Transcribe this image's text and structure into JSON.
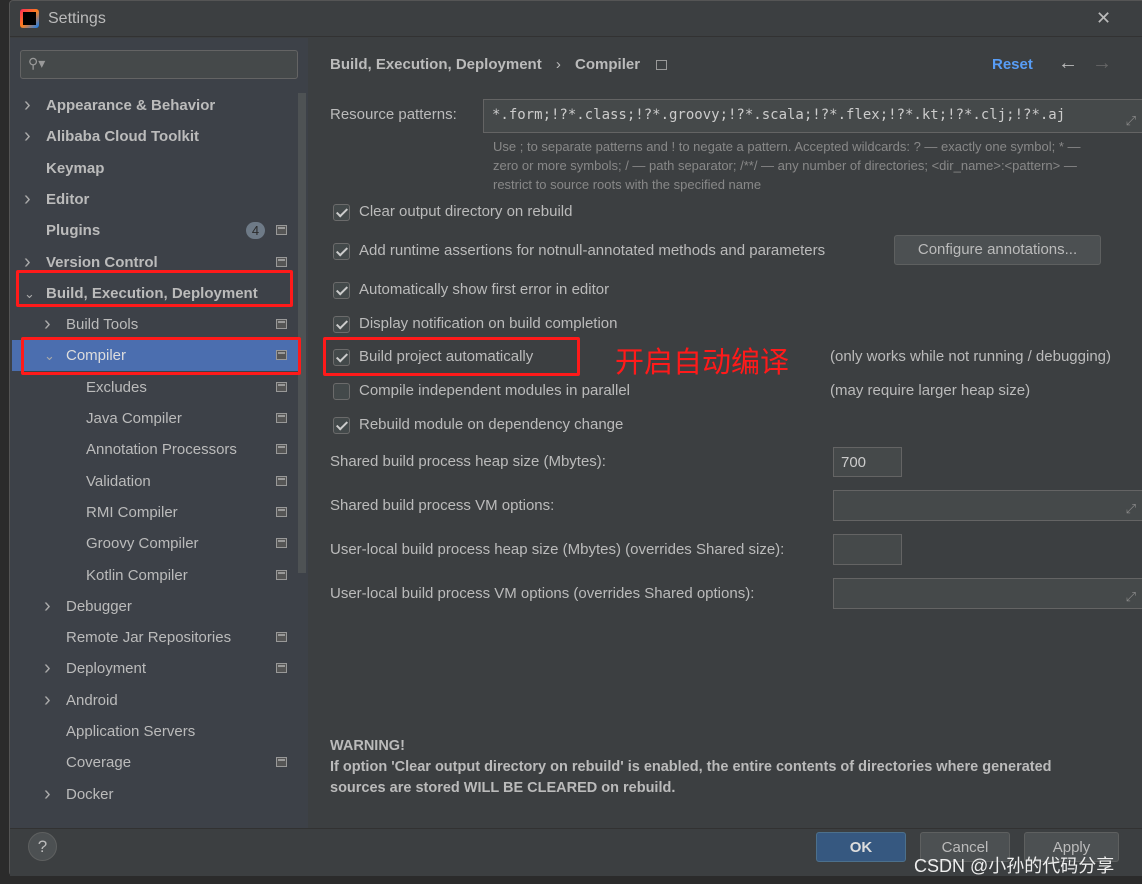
{
  "window": {
    "title": "Settings",
    "close": "✕"
  },
  "sidebar": {
    "items": [
      {
        "label": "Appearance & Behavior",
        "arrow": "›",
        "bold": true
      },
      {
        "label": "Alibaba Cloud Toolkit",
        "arrow": "›",
        "bold": true
      },
      {
        "label": "Keymap",
        "arrow": "",
        "bold": true
      },
      {
        "label": "Editor",
        "arrow": "›",
        "bold": true
      },
      {
        "label": "Plugins",
        "arrow": "",
        "bold": true,
        "badge": "4",
        "page": true
      },
      {
        "label": "Version Control",
        "arrow": "›",
        "bold": true,
        "page": true
      },
      {
        "label": "Build, Execution, Deployment",
        "arrow": "⌄",
        "bold": true
      },
      {
        "label": "Build Tools",
        "arrow": "›",
        "level": 1,
        "page": true
      },
      {
        "label": "Compiler",
        "arrow": "⌄",
        "level": 1,
        "page": true,
        "selected": true
      },
      {
        "label": "Excludes",
        "level": 2,
        "page": true
      },
      {
        "label": "Java Compiler",
        "level": 2,
        "page": true
      },
      {
        "label": "Annotation Processors",
        "level": 2,
        "page": true
      },
      {
        "label": "Validation",
        "level": 2,
        "page": true
      },
      {
        "label": "RMI Compiler",
        "level": 2,
        "page": true
      },
      {
        "label": "Groovy Compiler",
        "level": 2,
        "page": true
      },
      {
        "label": "Kotlin Compiler",
        "level": 2,
        "page": true
      },
      {
        "label": "Debugger",
        "arrow": "›",
        "level": 1
      },
      {
        "label": "Remote Jar Repositories",
        "level": 1,
        "page": true
      },
      {
        "label": "Deployment",
        "arrow": "›",
        "level": 1,
        "page": true
      },
      {
        "label": "Android",
        "arrow": "›",
        "level": 1
      },
      {
        "label": "Application Servers",
        "level": 1
      },
      {
        "label": "Coverage",
        "level": 1,
        "page": true
      },
      {
        "label": "Docker",
        "arrow": "›",
        "level": 1
      }
    ]
  },
  "header": {
    "crumb1": "Build, Execution, Deployment",
    "sep": "›",
    "crumb2": "Compiler",
    "reset": "Reset",
    "back": "←",
    "forward": "→"
  },
  "resource": {
    "label": "Resource patterns:",
    "value": "*.form;!?*.class;!?*.groovy;!?*.scala;!?*.flex;!?*.kt;!?*.clj;!?*.aj",
    "help1": "Use ; to separate patterns and ! to negate a pattern. Accepted wildcards: ? — exactly one symbol; * —",
    "help2": "zero or more symbols; / — path separator; /**/ — any number of directories; <dir_name>:<pattern> —",
    "help3": "restrict to source roots with the specified name"
  },
  "options": [
    {
      "label": "Clear output directory on rebuild",
      "checked": true
    },
    {
      "label": "Add runtime assertions for notnull-annotated methods and parameters",
      "checked": true
    },
    {
      "label": "Automatically show first error in editor",
      "checked": true
    },
    {
      "label": "Display notification on build completion",
      "checked": true
    },
    {
      "label": "Build project automatically",
      "checked": true,
      "note": "(only works while not running / debugging)"
    },
    {
      "label": "Compile independent modules in parallel",
      "checked": false,
      "note": "(may require larger heap size)"
    },
    {
      "label": "Rebuild module on dependency change",
      "checked": true
    }
  ],
  "configure_annotations": "Configure annotations...",
  "annotation": "开启自动编译",
  "fields": {
    "heap_label": "Shared build process heap size (Mbytes):",
    "heap_value": "700",
    "vm_label": "Shared build process VM options:",
    "user_heap_label": "User-local build process heap size (Mbytes) (overrides Shared size):",
    "user_vm_label": "User-local build process VM options (overrides Shared options):"
  },
  "warning": {
    "title": "WARNING!",
    "line1": "If option 'Clear output directory on rebuild' is enabled, the entire contents of directories where generated",
    "line2": "sources are stored WILL BE CLEARED on rebuild."
  },
  "footer": {
    "help": "?",
    "ok": "OK",
    "cancel": "Cancel",
    "apply": "Apply"
  },
  "watermark": "CSDN @小孙的代码分享",
  "colors": {
    "accent": "#4b6eaf",
    "link": "#589df6",
    "highlight": "#ff1a1a"
  }
}
